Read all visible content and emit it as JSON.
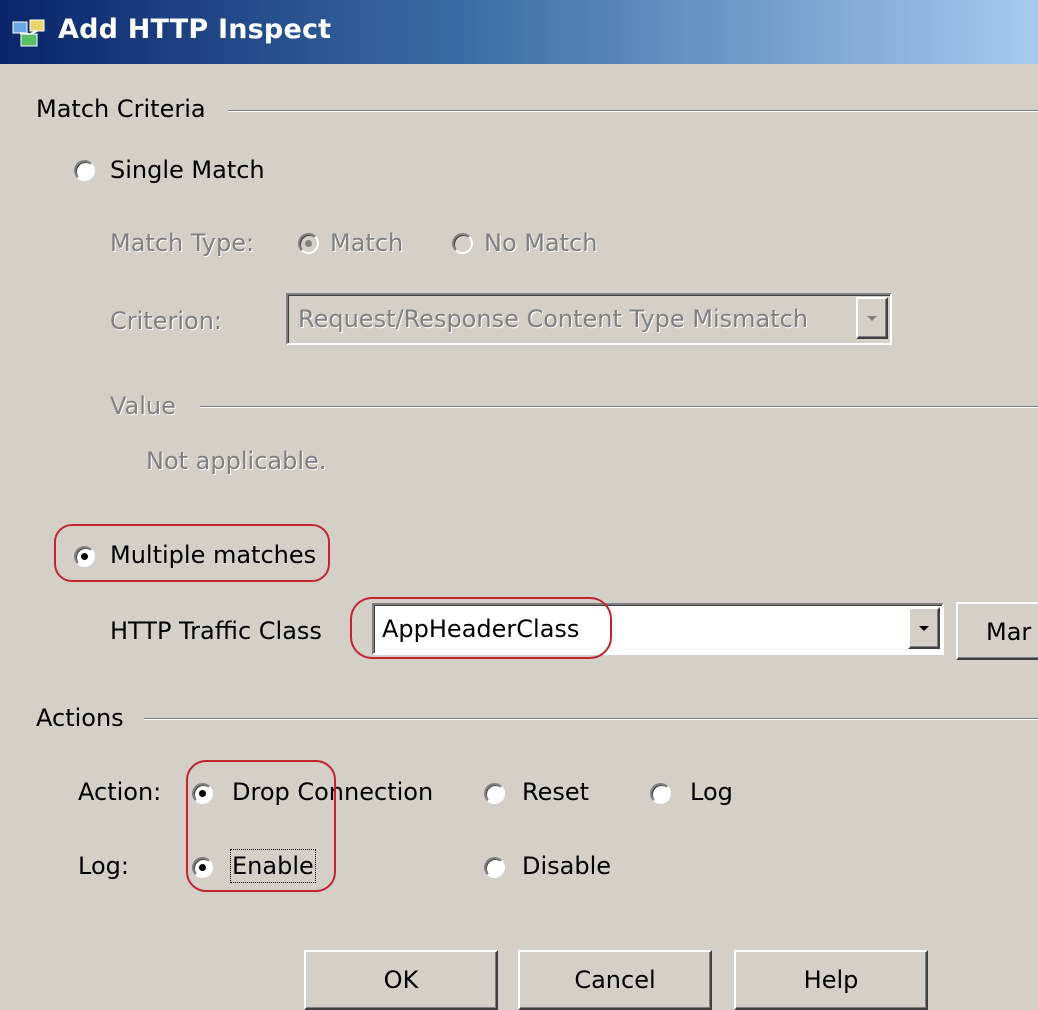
{
  "window": {
    "title": "Add HTTP Inspect",
    "icon": "network-app-icon"
  },
  "match_criteria": {
    "label": "Match Criteria",
    "single_match": {
      "label": "Single Match",
      "selected": false
    },
    "match_type": {
      "label": "Match Type:",
      "options": [
        "Match",
        "No Match"
      ],
      "selected": "Match"
    },
    "criterion": {
      "label": "Criterion:",
      "value": "Request/Response Content Type Mismatch"
    },
    "value_group": {
      "label": "Value",
      "text": "Not applicable."
    },
    "multiple_matches": {
      "label": "Multiple matches",
      "selected": true
    },
    "traffic_class": {
      "label": "HTTP Traffic Class",
      "value": "AppHeaderClass",
      "manage_button": "Mar"
    }
  },
  "actions": {
    "label": "Actions",
    "action": {
      "label": "Action:",
      "options": [
        "Drop Connection",
        "Reset",
        "Log"
      ],
      "selected": "Drop Connection"
    },
    "log": {
      "label": "Log:",
      "options": [
        "Enable",
        "Disable"
      ],
      "selected": "Enable"
    }
  },
  "buttons": {
    "ok": "OK",
    "cancel": "Cancel",
    "help": "Help"
  },
  "colors": {
    "dialog_bg": "#d4d0c8",
    "titlebar_start": "#0a246a",
    "titlebar_end": "#a6caf0",
    "highlight": "#c0262c",
    "disabled_text": "#808080"
  }
}
